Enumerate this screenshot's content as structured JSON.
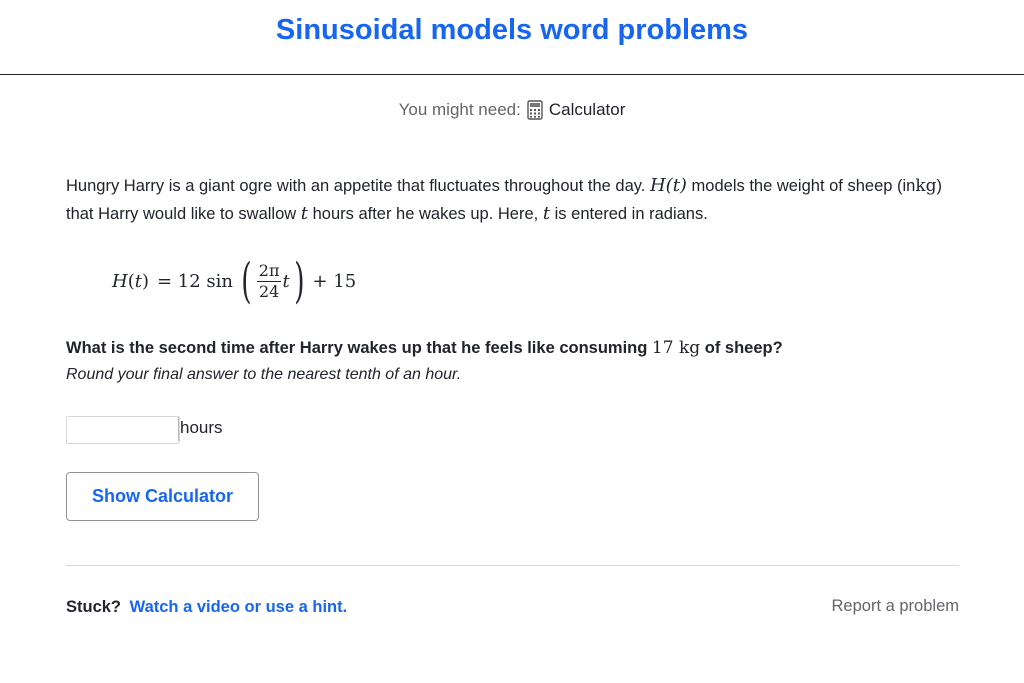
{
  "header": {
    "title": "Sinusoidal models word problems"
  },
  "needs": {
    "label": "You might need:",
    "tool_icon": "calculator-icon",
    "tool": "Calculator"
  },
  "problem": {
    "p1": "Hungry Harry is a giant ogre with an appetite that fluctuates throughout the day.",
    "ht": "H(t)",
    "p2": "models the weight of sheep (in",
    "kg": "kg",
    "p3": ") that Harry would like to swallow",
    "t1": "t",
    "p4": "hours after he wakes up. Here,",
    "t2": "t",
    "p5": "is entered in radians."
  },
  "formula": {
    "lhs": "H",
    "var": "t",
    "eq": "= 12 sin",
    "num": "2π",
    "den": "24",
    "inner_var": "t",
    "tail": "+ 15"
  },
  "question": {
    "q1": "What is the second time after Harry wakes up that he feels like consuming",
    "value": "17 kg",
    "q2": "of sheep?",
    "instruction": "Round your final answer to the nearest tenth of an hour."
  },
  "answer": {
    "value": "",
    "unit": "hours"
  },
  "buttons": {
    "show_calculator": "Show Calculator"
  },
  "footer": {
    "stuck": "Stuck?",
    "hint_link": "Watch a video or use a hint.",
    "report": "Report a problem"
  },
  "colors": {
    "accent": "#1865f2",
    "text": "#21242c",
    "muted": "#626569"
  }
}
